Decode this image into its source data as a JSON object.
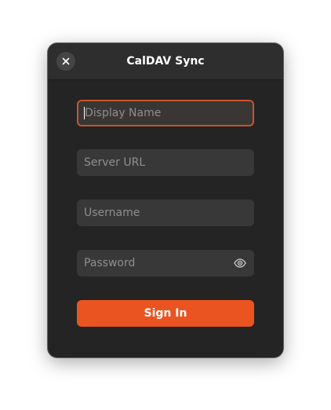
{
  "window": {
    "title": "CalDAV Sync"
  },
  "header": {
    "close_icon": "close-icon"
  },
  "form": {
    "display_name": {
      "placeholder": "Display Name",
      "value": ""
    },
    "server_url": {
      "placeholder": "Server URL",
      "value": ""
    },
    "username": {
      "placeholder": "Username",
      "value": ""
    },
    "password": {
      "placeholder": "Password",
      "value": "",
      "reveal_icon": "eye-icon"
    },
    "sign_in_label": "Sign In"
  },
  "colors": {
    "accent": "#e95420",
    "focus_border": "#c7562d",
    "dialog_bg": "#242424",
    "field_bg": "#383838"
  }
}
